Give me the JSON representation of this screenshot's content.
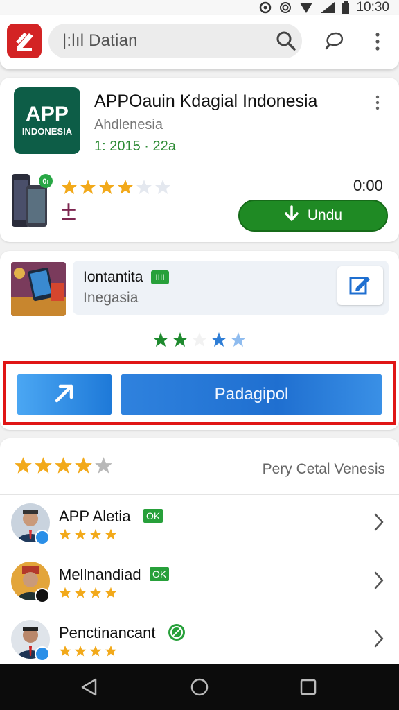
{
  "status_bar": {
    "time": "10:30"
  },
  "search": {
    "query": "|:lıl Datian"
  },
  "app": {
    "icon_text_1": "APP",
    "icon_text_2": "INDONESIA",
    "title": "APPOauin Kdagial Indonesia",
    "developer": "Ahdlenesia",
    "meta": "1: 2015 · 22a",
    "rating_stars": 4,
    "phone_badge": "0ı",
    "price": "0:00",
    "plusminus": "±",
    "install_label": "Undu"
  },
  "feature": {
    "name": "Iontantita",
    "badge": "IIII",
    "subtitle": "Inegasia",
    "primary_button": "Padagipol"
  },
  "reviews": {
    "title": "Pery Cetal Venesis",
    "overall_stars": 4,
    "items": [
      {
        "name": "APP Aletia",
        "badge": "OK",
        "stars": 4
      },
      {
        "name": "Mellnandiad",
        "badge": "OK",
        "stars": 4
      },
      {
        "name": "Penctinancant",
        "badge": "",
        "stars": 4
      }
    ]
  },
  "colors": {
    "brand_red": "#d32324",
    "install_green": "#1f8a24",
    "primary_blue": "#1f6fd0",
    "star_gold": "#f2a91a",
    "highlight_red": "#e01515"
  }
}
